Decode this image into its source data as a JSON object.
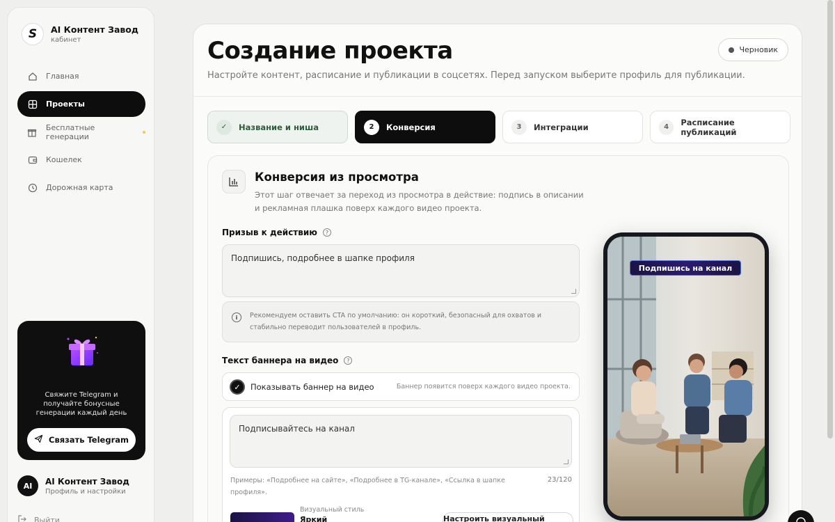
{
  "brand": {
    "title": "AI Контент Завод",
    "subtitle": "кабинет"
  },
  "nav": [
    {
      "label": "Главная",
      "icon": "home-icon"
    },
    {
      "label": "Проекты",
      "icon": "grid-icon",
      "active": true
    },
    {
      "label": "Бесплатные генерации",
      "icon": "gift-icon"
    },
    {
      "label": "Кошелек",
      "icon": "wallet-icon"
    },
    {
      "label": "Дорожная карта",
      "icon": "clock-icon"
    }
  ],
  "promo": {
    "text": "Свяжите Telegram и получайте бонусные генерации каждый день",
    "button": "Связать Telegram"
  },
  "profile": {
    "initials": "AI",
    "name": "AI Контент Завод",
    "subtitle": "Профиль и настройки"
  },
  "logout": "Выйти",
  "page": {
    "title": "Создание проекта",
    "description": "Настройте контент, расписание и публикации в соцсетях. Перед запуском выберите профиль для публикации.",
    "status": "Черновик"
  },
  "steps": [
    {
      "num": "✓",
      "label": "Название и ниша",
      "state": "done"
    },
    {
      "num": "2",
      "label": "Конверсия",
      "state": "current"
    },
    {
      "num": "3",
      "label": "Интеграции",
      "state": "pending"
    },
    {
      "num": "4",
      "label": "Расписание публикаций",
      "state": "pending"
    }
  ],
  "section": {
    "title": "Конверсия из просмотра",
    "description": "Этот шаг отвечает за переход из просмотра в действие: подпись в описании и рекламная плашка поверх каждого видео проекта.",
    "cta_label": "Призыв к действию",
    "cta_value": "Подпишись, подробнее в шапке профиля",
    "note": "Рекомендуем оставить CTA по умолчанию: он короткий, безопасный для охватов и стабильно переводит пользователей в профиль.",
    "banner_label": "Текст баннера на видео",
    "toggle_label": "Показывать баннер на видео",
    "toggle_hint": "Баннер появится поверх каждого видео проекта.",
    "banner_value": "Подписывайтесь на канал",
    "examples": "Примеры: «Подробнее на сайте», «Подробнее в TG-канале», «Ссылка в шапке профиля».",
    "counter": "23/120",
    "style_caption": "Визуальный стиль",
    "style_value": "Яркий",
    "style_button": "Настроить визуальный лейбл"
  },
  "preview": {
    "badge": "Подпишись на канал"
  },
  "colors": {
    "accent": "#0d0d0d",
    "done_bg": "#eef3ef",
    "banner": "#2c1b70"
  }
}
